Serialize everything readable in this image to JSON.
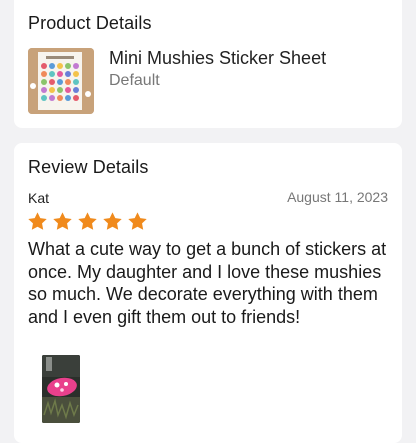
{
  "product_section": {
    "title": "Product Details",
    "product_name": "Mini Mushies Sticker Sheet",
    "variant": "Default",
    "thumbnail_icon": "sticker-sheet-image"
  },
  "review_section": {
    "title": "Review Details",
    "reviewer": "Kat",
    "date": "August 11, 2023",
    "rating": 5,
    "rating_max": 5,
    "star_color": "#f08a1c",
    "text": "What a cute way to get a bunch of stickers at once. My daughter and I love these mushies so much. We decorate everything with them and I even gift them out to friends!",
    "photo_icon": "review-photo"
  }
}
